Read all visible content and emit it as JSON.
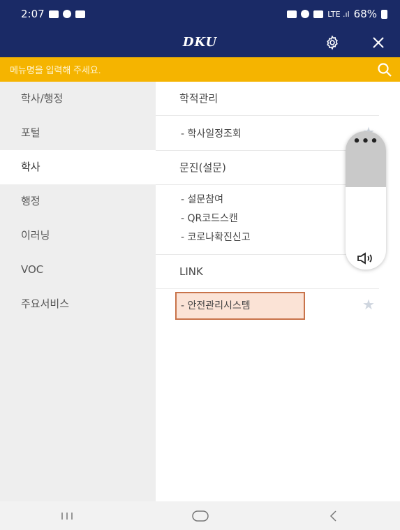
{
  "status": {
    "time": "2:07",
    "battery": "68%"
  },
  "header": {
    "logo": "DKU"
  },
  "search": {
    "placeholder": "메뉴명을 입력해 주세요."
  },
  "sidebar": {
    "items": [
      {
        "label": "학사/행정",
        "active": false
      },
      {
        "label": "포털",
        "active": false
      },
      {
        "label": "학사",
        "active": true
      },
      {
        "label": "행정",
        "active": false
      },
      {
        "label": "이러닝",
        "active": false
      },
      {
        "label": "VOC",
        "active": false
      },
      {
        "label": "주요서비스",
        "active": false
      }
    ]
  },
  "content": {
    "category1": {
      "title": "학적관리",
      "items": [
        "- 학사일정조회"
      ]
    },
    "category2": {
      "title": "문진(설문)",
      "items": [
        "- 설문참여",
        "- QR코드스캔",
        "- 코로나확진신고"
      ]
    },
    "category3": {
      "title": "LINK",
      "items": [
        "- 안전관리시스템"
      ]
    }
  },
  "colors": {
    "header_bg": "#1a2a66",
    "search_bg": "#f5b400",
    "highlight_border": "#c8734a"
  },
  "icons": [
    "gear-icon",
    "close-icon",
    "search-icon",
    "star-icon",
    "more-icon",
    "volume-icon",
    "recent-apps-icon",
    "home-icon",
    "back-icon"
  ]
}
